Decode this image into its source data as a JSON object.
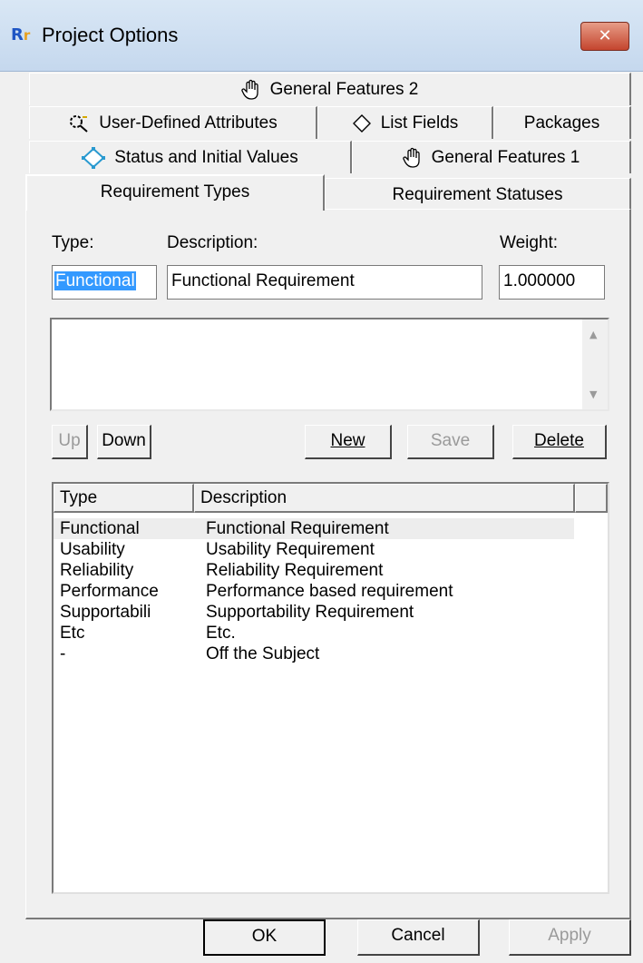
{
  "window": {
    "title": "Project Options",
    "app_icon_text": "R",
    "close_glyph": "✕"
  },
  "tabs": {
    "row1": [
      {
        "label": "General Features 2",
        "icon": "hand-icon"
      }
    ],
    "row2": [
      {
        "label": "User-Defined Attributes",
        "icon": "attributes-icon"
      },
      {
        "label": "List Fields",
        "icon": "diamond-icon"
      },
      {
        "label": "Packages",
        "icon": ""
      }
    ],
    "row3": [
      {
        "label": "Status and Initial Values",
        "icon": "status-icon"
      },
      {
        "label": "General Features 1",
        "icon": "hand-icon"
      }
    ],
    "row4": [
      {
        "label": "Requirement Types",
        "active": true
      },
      {
        "label": "Requirement Statuses",
        "active": false
      }
    ]
  },
  "form": {
    "type_label": "Type:",
    "description_label": "Description:",
    "weight_label": "Weight:",
    "type_value": "Functional",
    "description_value": "Functional Requirement",
    "weight_value": "1.000000",
    "memo_value": ""
  },
  "buttons": {
    "up": "Up",
    "down": "Down",
    "new": "New",
    "save": "Save",
    "delete": "Delete"
  },
  "list": {
    "columns": [
      "Type",
      "Description"
    ],
    "rows": [
      {
        "type": "Functional",
        "description": "Functional Requirement",
        "selected": true
      },
      {
        "type": "Usability",
        "description": "Usability Requirement"
      },
      {
        "type": "Reliability",
        "description": "Reliability Requirement"
      },
      {
        "type": "Performance",
        "description": "Performance based requirement"
      },
      {
        "type": "Supportabili",
        "description": "Supportability Requirement"
      },
      {
        "type": "Etc",
        "description": "Etc."
      },
      {
        "type": "-",
        "description": "Off the Subject"
      }
    ]
  },
  "footer": {
    "ok": "OK",
    "cancel": "Cancel",
    "apply": "Apply"
  }
}
